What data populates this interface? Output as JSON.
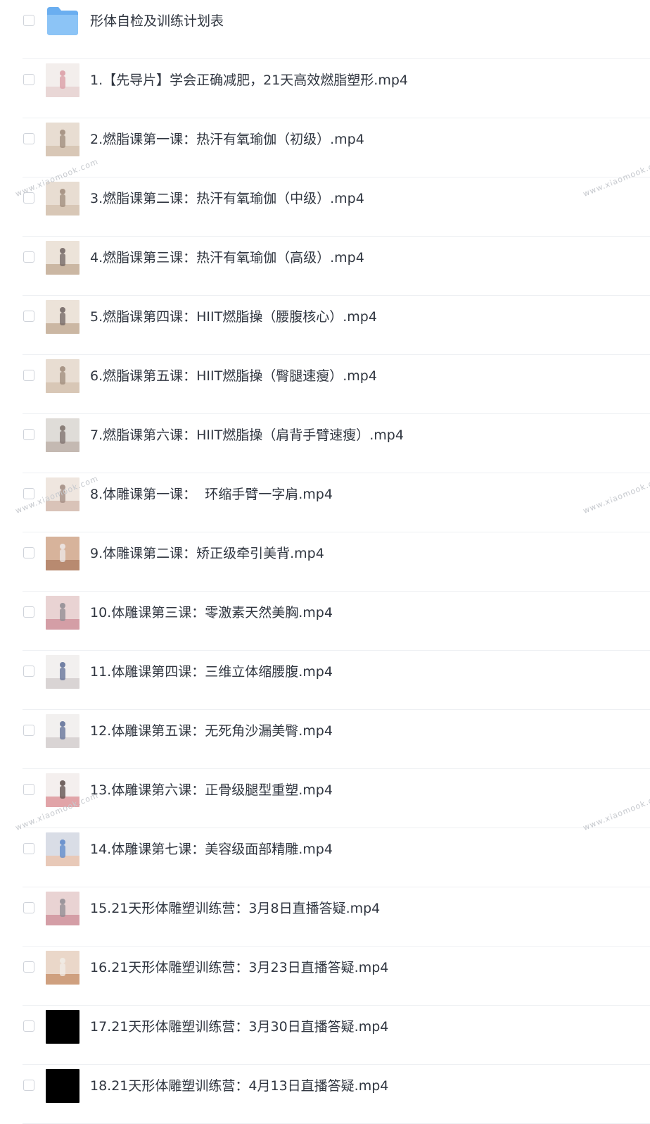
{
  "folder": {
    "name": "形体自检及训练计划表",
    "icon": "folder-icon"
  },
  "files": [
    {
      "name": "1.【先导片】学会正确减肥，21天高效燃脂塑形.mp4",
      "thumb": "light-pink"
    },
    {
      "name": "2.燃脂课第一课：热汗有氧瑜伽（初级）.mp4",
      "thumb": "beige"
    },
    {
      "name": "3.燃脂课第二课：热汗有氧瑜伽（中级）.mp4",
      "thumb": "beige"
    },
    {
      "name": "4.燃脂课第三课：热汗有氧瑜伽（高级）.mp4",
      "thumb": "beige-floor"
    },
    {
      "name": "5.燃脂课第四课：HIIT燃脂操（腰腹核心）.mp4",
      "thumb": "beige-floor"
    },
    {
      "name": "6.燃脂课第五课：HIIT燃脂操（臀腿速瘦）.mp4",
      "thumb": "beige"
    },
    {
      "name": "7.燃脂课第六课：HIIT燃脂操（肩背手臂速瘦）.mp4",
      "thumb": "grey"
    },
    {
      "name": "8.体雕课第一课：  环缩手臂一字肩.mp4",
      "thumb": "arch"
    },
    {
      "name": "9.体雕课第二课：矫正级牵引美背.mp4",
      "thumb": "warm"
    },
    {
      "name": "10.体雕课第三课：零激素天然美胸.mp4",
      "thumb": "pink-studio"
    },
    {
      "name": "11.体雕课第四课：三维立体缩腰腹.mp4",
      "thumb": "white-floor"
    },
    {
      "name": "12.体雕课第五课：无死角沙漏美臀.mp4",
      "thumb": "white-floor"
    },
    {
      "name": "13.体雕课第六课：正骨级腿型重塑.mp4",
      "thumb": "pink-mat"
    },
    {
      "name": "14.体雕课第七课：美容级面部精雕.mp4",
      "thumb": "face"
    },
    {
      "name": "15.21天形体雕塑训练营：3月8日直播答疑.mp4",
      "thumb": "pink-studio"
    },
    {
      "name": "16.21天形体雕塑训练营：3月23日直播答疑.mp4",
      "thumb": "warm-studio"
    },
    {
      "name": "17.21天形体雕塑训练营：3月30日直播答疑.mp4",
      "thumb": "black"
    },
    {
      "name": "18.21天形体雕塑训练营：4月13日直播答疑.mp4",
      "thumb": "black"
    }
  ],
  "watermark": "www.xiaomook.com",
  "colors": {
    "text": "#303640",
    "divider": "#eef0f3",
    "checkbox_border": "#cfd3da",
    "folder": "#7dbaf2",
    "watermark": "#c6c9ce"
  }
}
